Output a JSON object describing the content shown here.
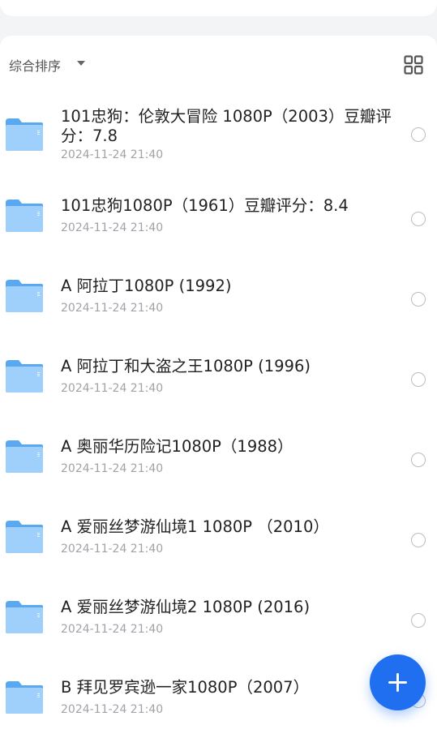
{
  "toolbar": {
    "sort_label": "综合排序",
    "sort_caret_icon": "caret-down-icon",
    "view_toggle_icon": "grid-view-icon"
  },
  "files": [
    {
      "title": "101忠狗：伦敦大冒险 1080P（2003）豆瓣评分：7.8",
      "date": "2024-11-24 21:40"
    },
    {
      "title": "101忠狗1080P（1961）豆瓣评分：8.4",
      "date": "2024-11-24 21:40"
    },
    {
      "title": "A 阿拉丁1080P (1992)",
      "date": "2024-11-24 21:40"
    },
    {
      "title": "A 阿拉丁和大盗之王1080P (1996)",
      "date": "2024-11-24 21:40"
    },
    {
      "title": "A 奥丽华历险记1080P（1988）",
      "date": "2024-11-24 21:40"
    },
    {
      "title": "A 爱丽丝梦游仙境1 1080P （2010）",
      "date": "2024-11-24 21:40"
    },
    {
      "title": "A 爱丽丝梦游仙境2 1080P (2016)",
      "date": "2024-11-24 21:40"
    },
    {
      "title": "B 拜见罗宾逊一家1080P（2007）",
      "date": "2024-11-24 21:40"
    }
  ],
  "fab": {
    "icon": "plus-icon"
  },
  "colors": {
    "accent": "#1f6ff0",
    "folder_light": "#9fd0fb",
    "folder_dark": "#5aa8ef",
    "date_text": "#a0a3a8"
  }
}
